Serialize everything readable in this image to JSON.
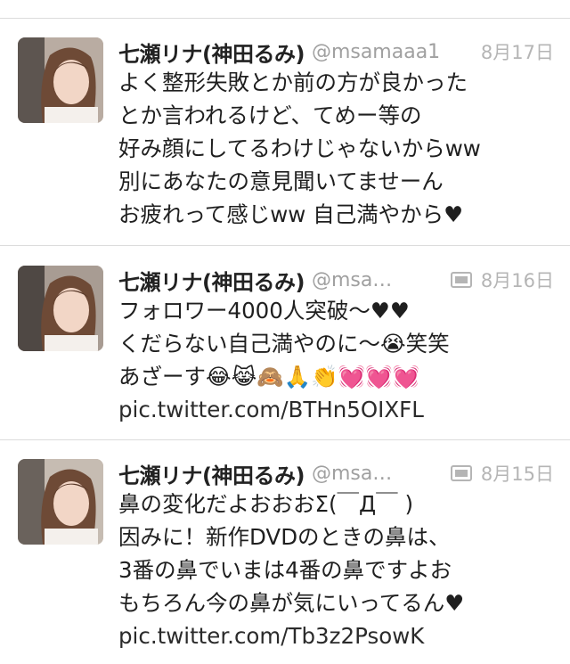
{
  "tweets": [
    {
      "name": "七瀬リナ(神田るみ)",
      "handle": "@msamaaa1",
      "date": "8月17日",
      "has_media": false,
      "lines": [
        "よく整形失敗とか前の方が良かった",
        "とか言われるけど、てめー等の",
        "好み顔にしてるわけじゃないからww",
        "別にあなたの意見聞いてませーん",
        "お疲れって感じww 自己満やから♥"
      ]
    },
    {
      "name": "七瀬リナ(神田るみ)",
      "handle": "@msa…",
      "date": "8月16日",
      "has_media": true,
      "media_icon": "photo-media-icon",
      "lines": [
        "フォロワー4000人突破〜♥♥",
        "くだらない自己満やのに〜😭笑笑",
        "あざーす😂😹🙈🙏👏💓💓💓"
      ],
      "link": "pic.twitter.com/BTHn5OIXFL"
    },
    {
      "name": "七瀬リナ(神田るみ)",
      "handle": "@msa…",
      "date": "8月15日",
      "has_media": true,
      "media_icon": "photo-media-icon",
      "lines": [
        "鼻の変化だよおおおΣ(￣Д￣ )",
        "因みに！新作DVDのときの鼻は、",
        "3番の鼻でいまは4番の鼻ですよお",
        "もちろん今の鼻が気にいってるん♥"
      ],
      "link": "pic.twitter.com/Tb3z2PsowK"
    }
  ]
}
